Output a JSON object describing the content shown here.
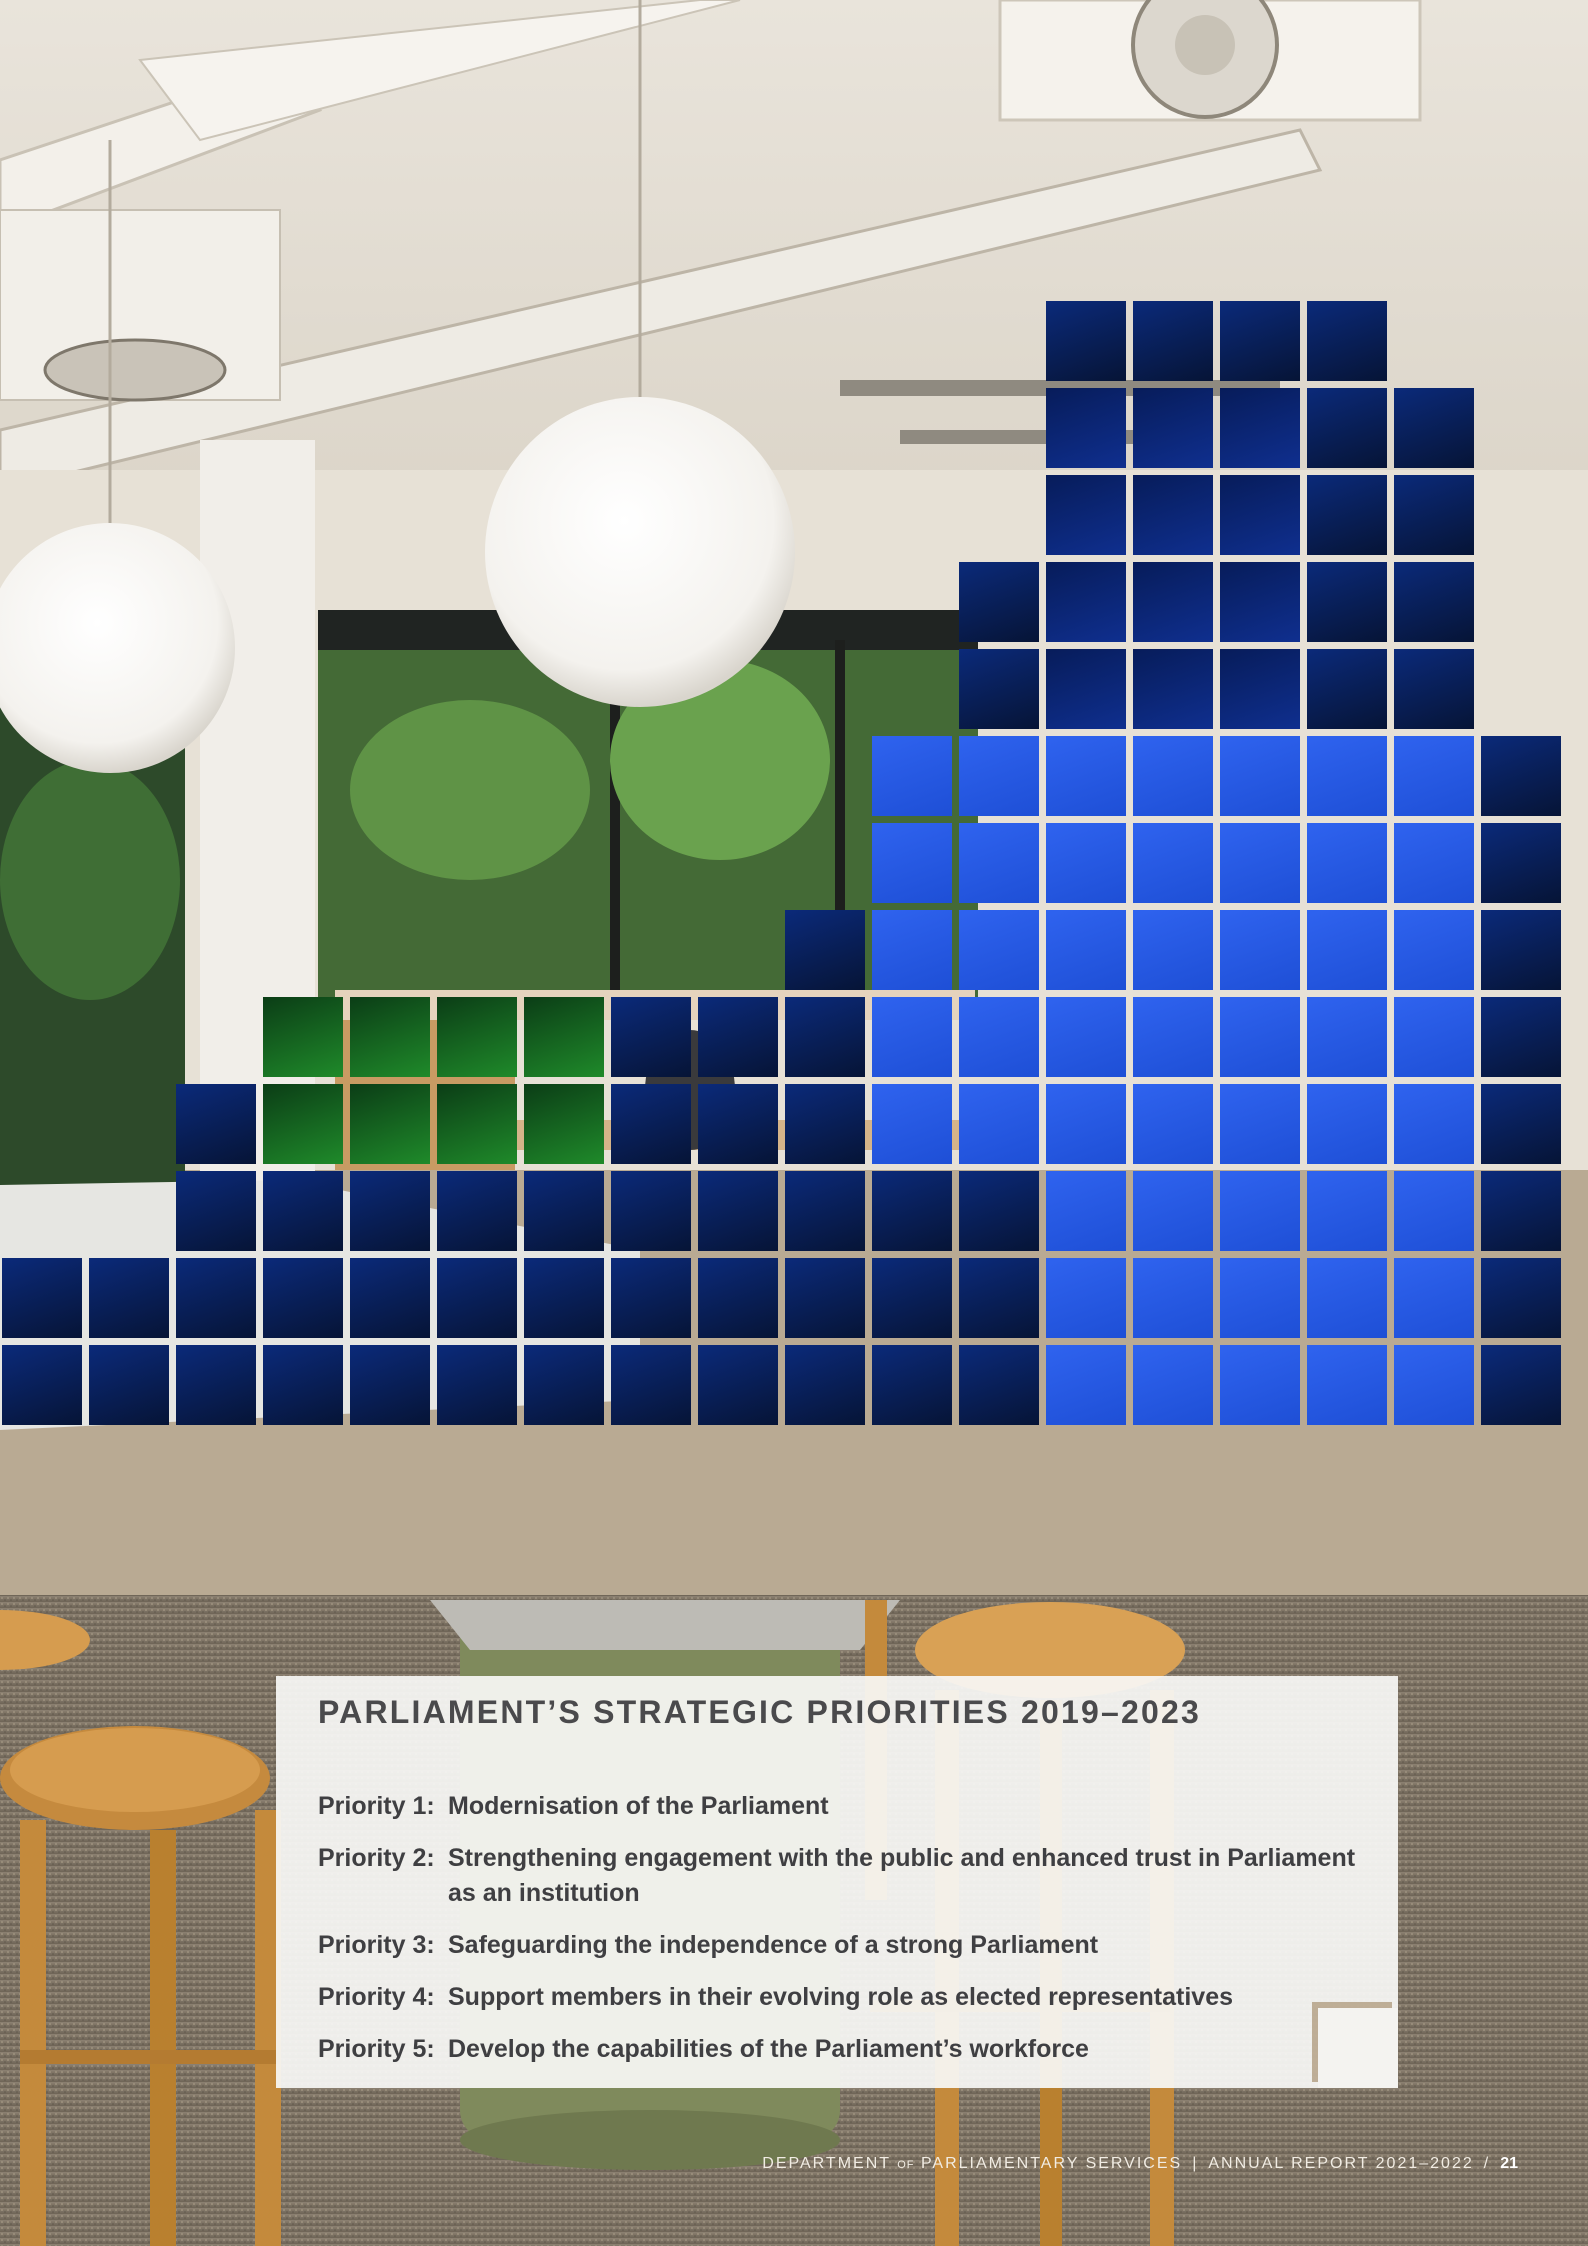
{
  "panel": {
    "title": "PARLIAMENT’S STRATEGIC PRIORITIES 2019–2023",
    "priorities": [
      {
        "label": "Priority 1:",
        "text": "Modernisation of the Parliament"
      },
      {
        "label": "Priority 2:",
        "text": "Strengthening engagement with the public and enhanced trust in Parliament as an institution"
      },
      {
        "label": "Priority 3:",
        "text": "Safeguarding the independence of a strong Parliament"
      },
      {
        "label": "Priority 4:",
        "text": "Support members in their evolving role as elected representatives"
      },
      {
        "label": "Priority 5:",
        "text": "Develop the capabilities of the Parliament’s workforce"
      }
    ]
  },
  "footer": {
    "department_a": "DEPARTMENT",
    "department_of": "OF",
    "department_b": "PARLIAMENTARY SERVICES",
    "separator": "|",
    "report": "ANNUAL REPORT 2021–2022",
    "slash": "/",
    "page_number": "21"
  },
  "colors": {
    "tile_blue": "#1e4fd6",
    "tile_dark": "#061436",
    "tile_green": "#1f8a2a",
    "panel_bg": "#f8f7f5",
    "title_text": "#4a4a4c"
  },
  "icons": {
    "mosaic": "blue-photo-mosaic-overlay"
  }
}
